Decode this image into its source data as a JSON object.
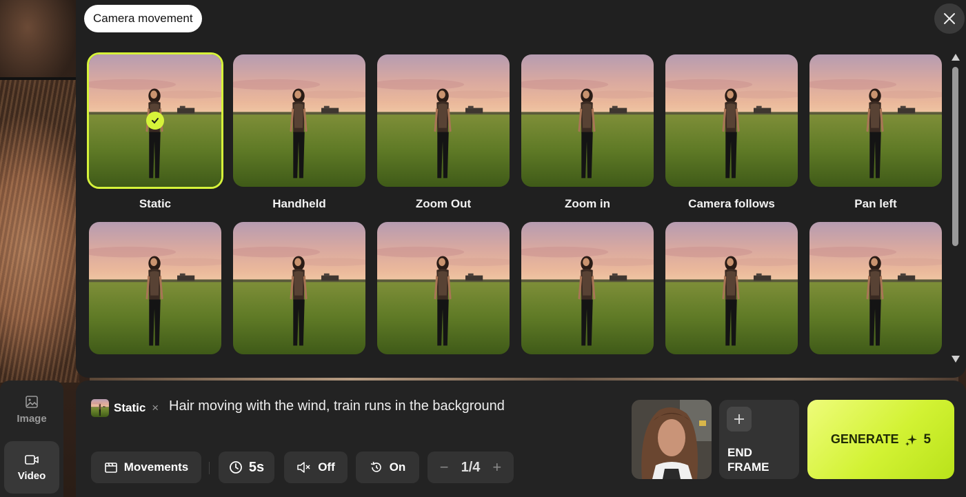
{
  "modal": {
    "title": "Camera movement",
    "close_icon": "close-icon",
    "items": [
      {
        "label": "Static",
        "selected": true
      },
      {
        "label": "Handheld",
        "selected": false
      },
      {
        "label": "Zoom Out",
        "selected": false
      },
      {
        "label": "Zoom in",
        "selected": false
      },
      {
        "label": "Camera follows",
        "selected": false
      },
      {
        "label": "Pan left",
        "selected": false
      },
      {
        "label": "",
        "selected": false
      },
      {
        "label": "",
        "selected": false
      },
      {
        "label": "",
        "selected": false
      },
      {
        "label": "",
        "selected": false
      },
      {
        "label": "",
        "selected": false
      },
      {
        "label": "",
        "selected": false
      }
    ]
  },
  "rail": {
    "image_label": "Image",
    "video_label": "Video"
  },
  "prompt": {
    "tag_label": "Static",
    "tag_remove": "×",
    "text": "Hair moving with the wind, train runs in the background"
  },
  "controls": {
    "movements_label": "Movements",
    "duration": "5s",
    "sound": "Off",
    "loop": "On",
    "pager_minus": "−",
    "pager_value": "1/4",
    "pager_plus": "+"
  },
  "end_frame": {
    "label_line1": "END",
    "label_line2": "FRAME"
  },
  "generate": {
    "label": "GENERATE",
    "cost": "5"
  },
  "colors": {
    "accent": "#d6f33a",
    "modal_bg": "#202020",
    "panel_bg": "#232323"
  }
}
